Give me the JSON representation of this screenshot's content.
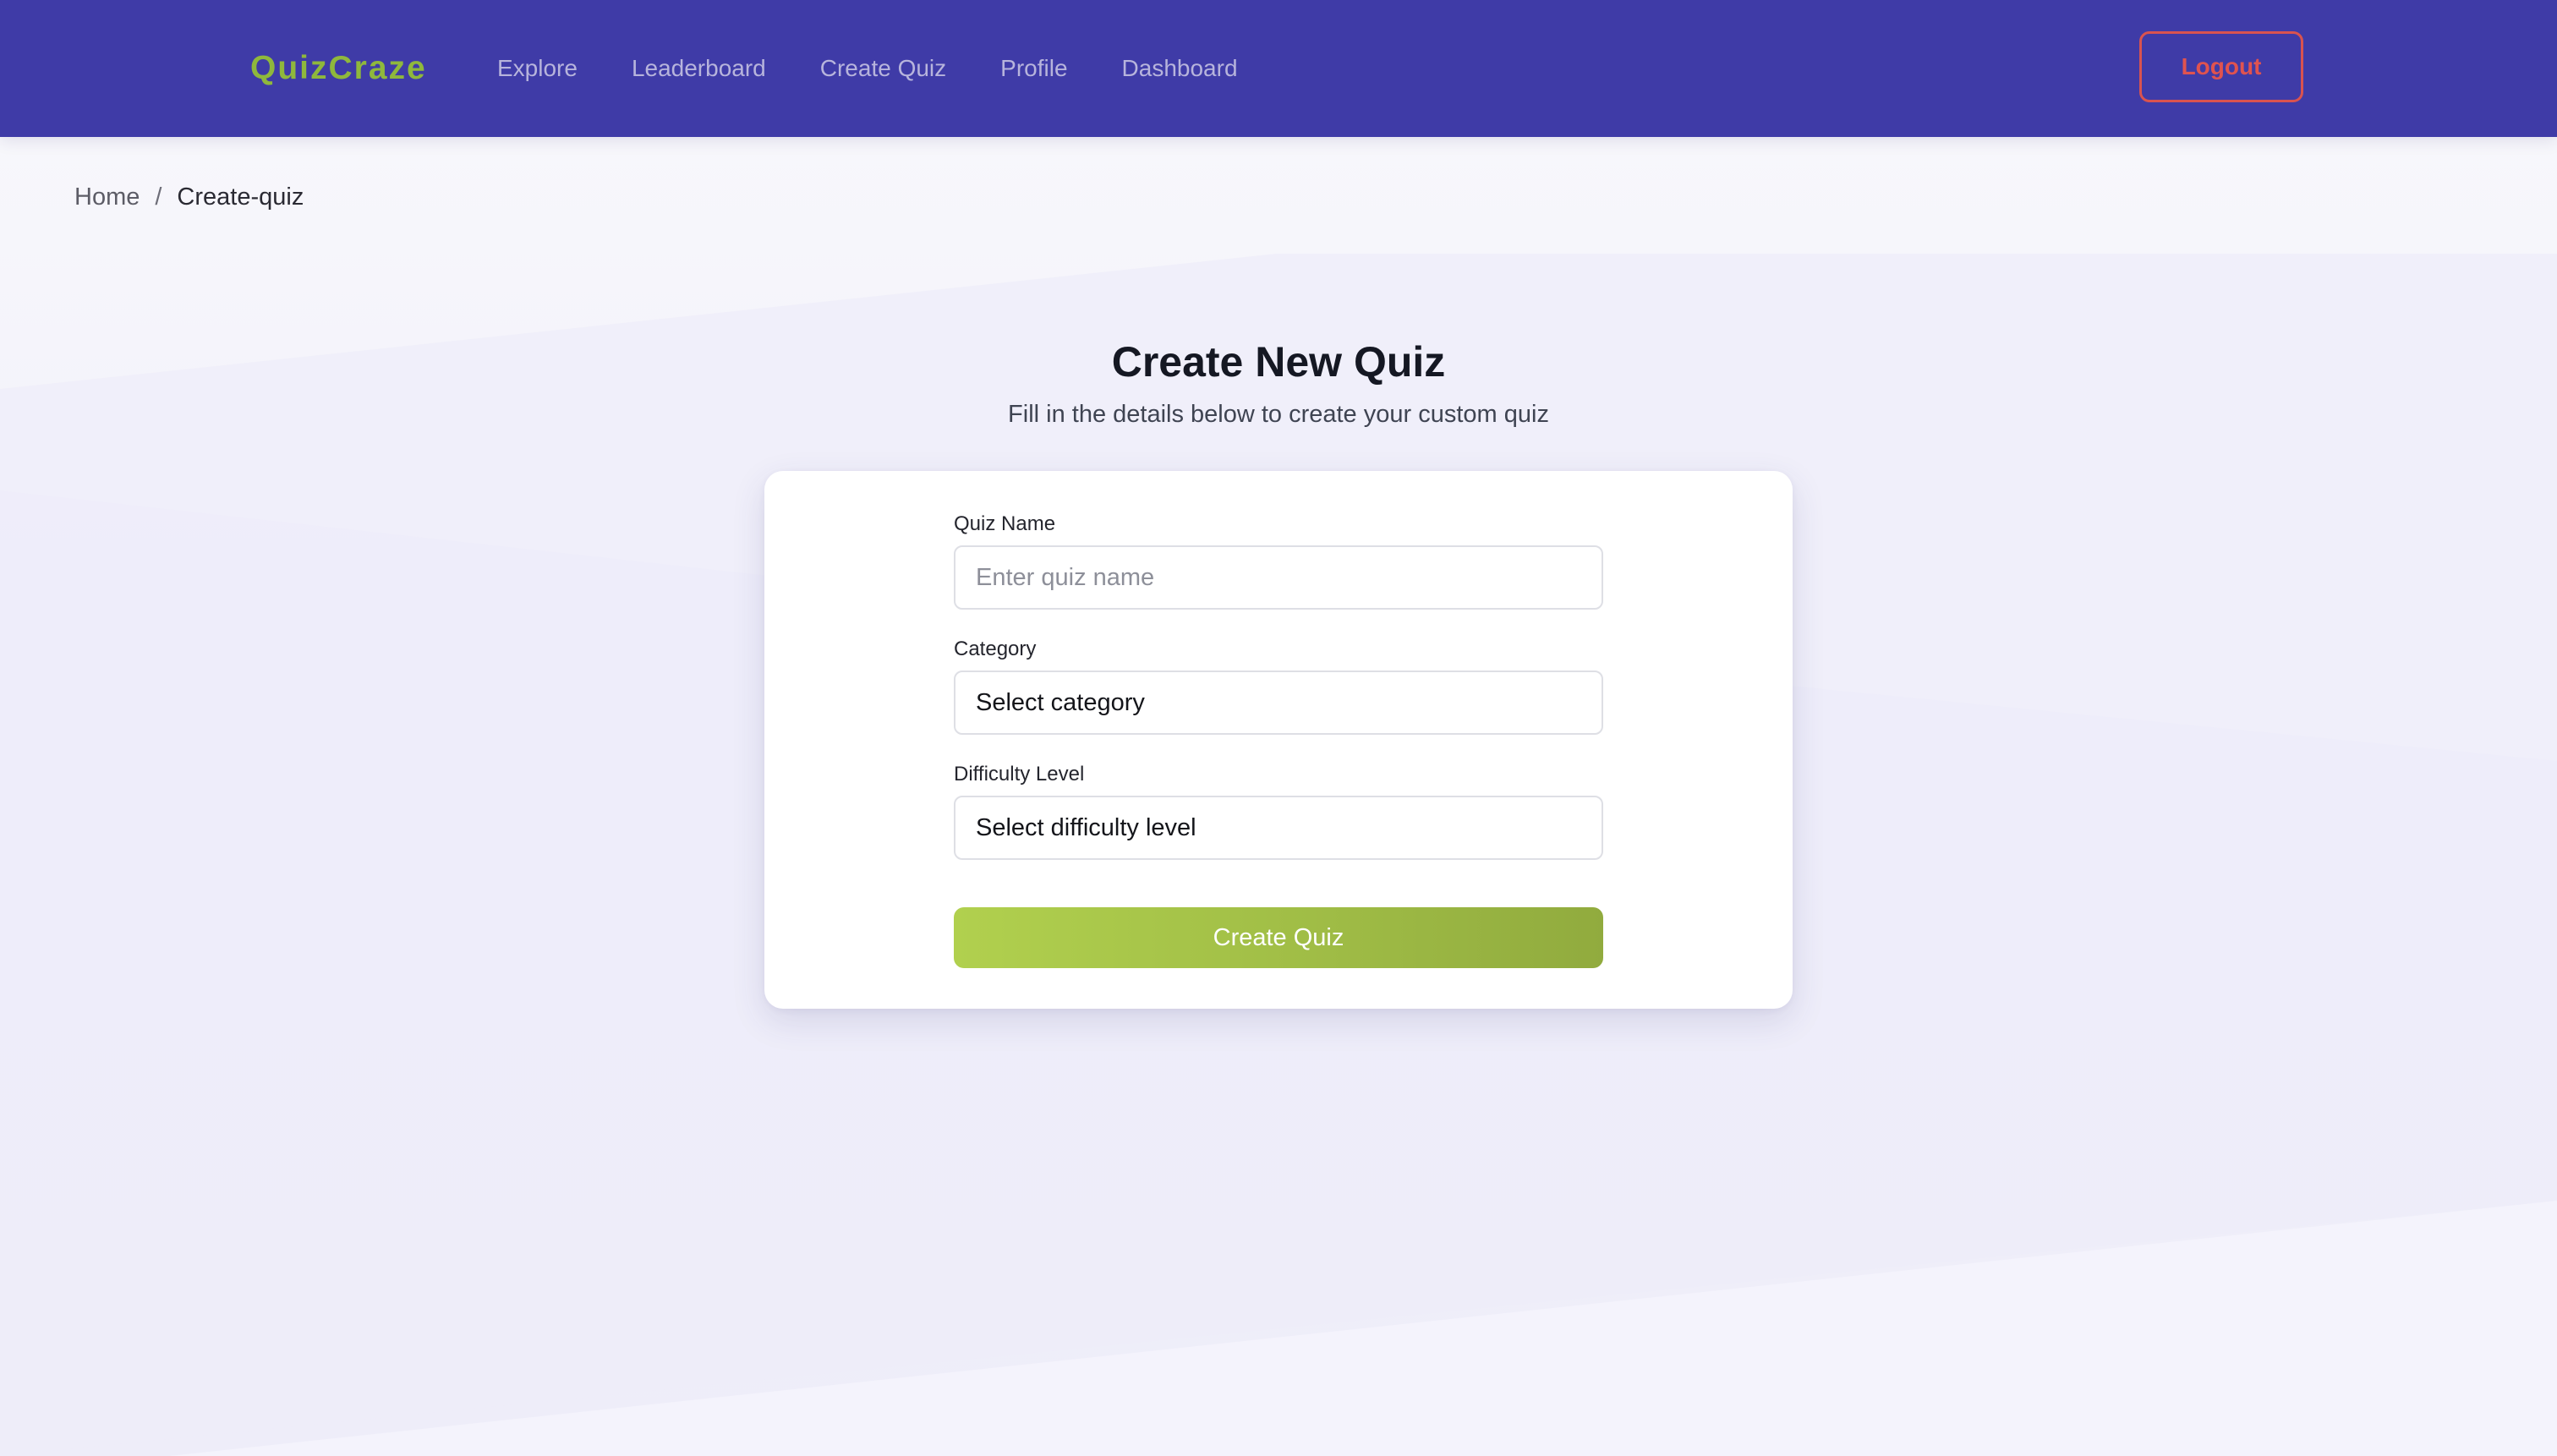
{
  "navbar": {
    "brand": "QuizCraze",
    "links": [
      "Explore",
      "Leaderboard",
      "Create Quiz",
      "Profile",
      "Dashboard"
    ],
    "logout_label": "Logout"
  },
  "breadcrumb": {
    "home": "Home",
    "separator": "/",
    "current": "Create-quiz"
  },
  "page": {
    "title": "Create New Quiz",
    "subtitle": "Fill in the details below to create your custom quiz"
  },
  "form": {
    "quiz_name": {
      "label": "Quiz Name",
      "placeholder": "Enter quiz name",
      "value": ""
    },
    "category": {
      "label": "Category",
      "selected": "Select category"
    },
    "difficulty": {
      "label": "Difficulty Level",
      "selected": "Select difficulty level"
    },
    "submit_label": "Create Quiz"
  },
  "colors": {
    "navbar_bg": "#3f3ba7",
    "brand": "#8fb83c",
    "logout": "#e0534f",
    "button_start": "#b1d04e",
    "button_end": "#91ab3e"
  }
}
